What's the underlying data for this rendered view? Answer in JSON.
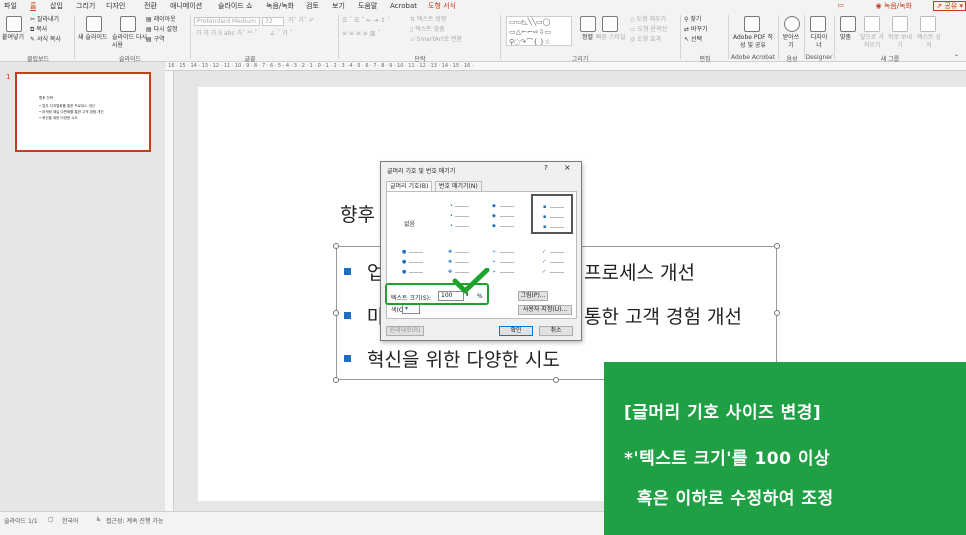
{
  "menu": {
    "tabs": [
      "파일",
      "홈",
      "삽입",
      "그리기",
      "디자인",
      "전환",
      "애니메이션",
      "슬라이드 쇼",
      "녹음/녹화",
      "검토",
      "보기",
      "도움말",
      "Acrobat",
      "도형 서식"
    ],
    "active_tab": "홈",
    "record_button": "◉ 녹음/녹화",
    "share_button": "공유"
  },
  "ribbon": {
    "clipboard": {
      "paste": "붙여넣기",
      "cut": "잘라내기",
      "copy": "복사",
      "format_painter": "서식 복사",
      "label": "클립보드"
    },
    "slides": {
      "new_slide": "새 슬라이드",
      "reuse": "슬라이드 다시 사용",
      "layout": "레이아웃",
      "reset": "다시 설정",
      "section": "구역",
      "label": "슬라이드"
    },
    "font": {
      "name": "Pretendard Medium",
      "size": "32",
      "label": "글꼴"
    },
    "paragraph": {
      "text_direction": "텍스트 방향",
      "align_text": "텍스트 맞춤",
      "smartart": "SmartArt로 변환",
      "label": "단락"
    },
    "drawing": {
      "arrange": "정렬",
      "quick_styles": "빠른 스타일",
      "fill": "도형 채우기",
      "outline": "도형 윤곽선",
      "effects": "도형 효과",
      "label": "그리기"
    },
    "editing": {
      "find": "찾기",
      "replace": "바꾸기",
      "select": "선택",
      "label": "편집"
    },
    "acrobat": {
      "create": "Adobe PDF 작성 및 공유",
      "label": "Adobe Acrobat"
    },
    "voice": {
      "dictate": "받아쓰기",
      "label": "음성"
    },
    "designer": {
      "designer": "디자이너",
      "label": "Designer"
    },
    "new_group": {
      "align": "맞춤",
      "top": "앞으로 가져오기",
      "back": "뒤로 보내기",
      "text": "텍스트 상자",
      "label": "새 그룹"
    }
  },
  "ruler_text": "· 16 · 15 · 14 · 13 · 12 · 11 · 10 · 9 · 8 · 7 · 6 · 5 · 4 · 3 · 2 · 1 · 0 · 1 · 2 · 3 · 4 · 5 · 6 · 7 · 8 · 9 · 10 · 11 · 12 · 13 · 14 · 15 · 16 ·",
  "thumbnail": {
    "number": "1",
    "title": "향후 전략",
    "lines": [
      "• 업무 디지털화를 통한 프로세스 개선",
      "• 마케팅 채널 다변화를 통한 고객 경험 개선",
      "• 혁신을 위한 다양한 시도"
    ]
  },
  "slide": {
    "title_visible": "향후",
    "bullets": [
      "업",
      "마",
      "혁신을 위한 다양한 시도"
    ],
    "bullet_tails": [
      "프로세스 개선",
      "통한 고객 경험 개선",
      ""
    ]
  },
  "dialog": {
    "title": "글머리 기호 및 번호 매기기",
    "help": "?",
    "close": "×",
    "tabs": [
      "글머리 기호(B)",
      "번호 매기기(N)"
    ],
    "none_label": "없음",
    "size_label": "텍스트 크기(S):",
    "size_value": "100",
    "percent": "%",
    "color_label": "색(C)",
    "picture_button": "그림(P)...",
    "customize_button": "사용자 지정(U)...",
    "reset_button": "원래대로(R)",
    "ok_button": "확인",
    "cancel_button": "취소",
    "accent_color": "#1fa12e"
  },
  "statusbar": {
    "slide_info": "슬라이드 1/1",
    "language": "한국어",
    "accessibility": "접근성: 계속 진행 가능"
  },
  "annotation": {
    "lines": [
      "[글머리 기호 사이즈 변경]",
      "*'텍스트 크기'를 100 이상",
      "  혹은 이하로 수정하여 조정"
    ],
    "background": "#1fa045"
  }
}
